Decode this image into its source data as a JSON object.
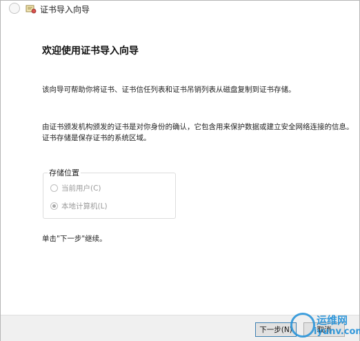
{
  "window": {
    "title": "证书导入向导"
  },
  "wizard": {
    "heading": "欢迎使用证书导入向导",
    "intro": "该向导可帮助你将证书、证书信任列表和证书吊销列表从磁盘复制到证书存储。",
    "desc_line1": "由证书颁发机构颁发的证书是对你身份的确认，它包含用来保护数据或建立安全网络连接的信息。",
    "desc_line2": "证书存储是保存证书的系统区域。",
    "store_location": {
      "label": "存储位置",
      "options": [
        {
          "label": "当前用户(C)",
          "selected": false
        },
        {
          "label": "本地计算机(L)",
          "selected": true
        }
      ]
    },
    "continue_hint": "单击\"下一步\"继续。"
  },
  "buttons": {
    "next": "下一步(N)",
    "cancel": "取消"
  },
  "watermark": {
    "cn": "运维网",
    "en": "iyunv.com"
  },
  "colors": {
    "accent": "#3c7fb1",
    "watermark": "#1f8fd8"
  }
}
